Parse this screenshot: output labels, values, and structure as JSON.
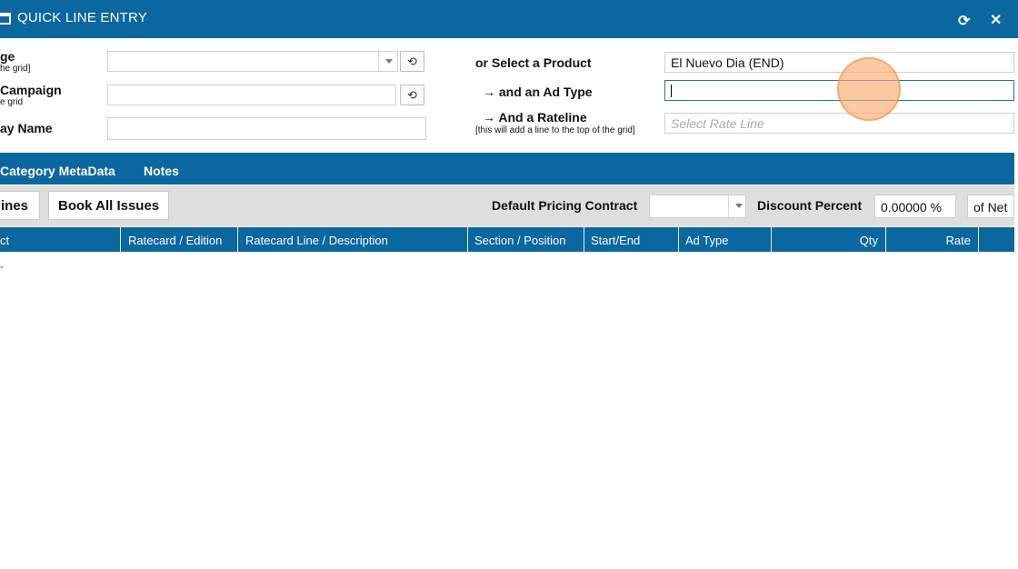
{
  "window": {
    "title": "QUICK LINE ENTRY",
    "refresh_icon": "refresh-icon",
    "close_icon": "close-icon",
    "refresh_glyph": "⟳",
    "close_glyph": "✕"
  },
  "form_left": {
    "row1_label": "ge",
    "row1_sub": "he grid]",
    "row2_label": "Campaign",
    "row2_sub": "e grid",
    "row3_label": "ay Name",
    "reload_glyph": "⟲"
  },
  "form_right": {
    "product_label": "or Select a Product",
    "product_value": "El Nuevo Dia (END)",
    "adtype_label": "→ and an Ad Type",
    "adtype_value": "",
    "rateline_label": "→ And a Rateline",
    "rateline_note": "[this will add a line to the top of the grid]",
    "rateline_placeholder": "Select Rate Line"
  },
  "tabs": [
    "Category MetaData",
    "Notes"
  ],
  "toolbar": {
    "lines_button": "ines",
    "book_all_button": "Book All Issues",
    "pricing_label": "Default Pricing Contract",
    "pricing_value": "",
    "discount_label": "Discount Percent",
    "discount_value": "0.00000 %",
    "of_net": "of Net"
  },
  "grid": {
    "columns": [
      "ct",
      "Ratecard / Edition",
      "Ratecard Line / Description",
      "Section / Position",
      "Start/End",
      "Ad Type",
      "Qty",
      "Rate"
    ],
    "row_placeholder": "-"
  },
  "colors": {
    "header_blue": "#0b679f",
    "toolbar_gray": "#dedede",
    "cursor_orange": "#f7a866"
  }
}
